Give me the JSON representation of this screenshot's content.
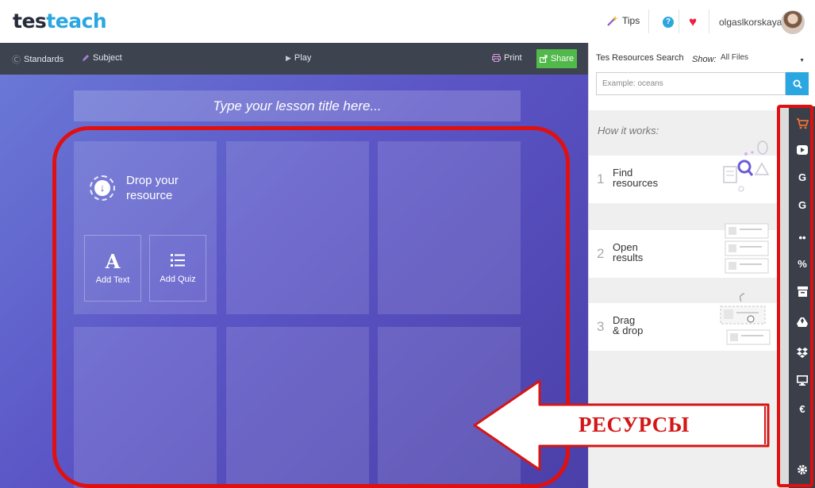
{
  "header": {
    "logo": {
      "tes": "tes",
      "teach": "teach"
    },
    "tips_label": "Tips",
    "username": "olgaslkorskaya"
  },
  "toolbar": {
    "standards_label": "Standards",
    "subject_label": "Subject",
    "play_label": "Play",
    "print_label": "Print",
    "share_label": "Share"
  },
  "lesson": {
    "title_placeholder": "Type your lesson title here...",
    "drop_text_line1": "Drop your",
    "drop_text_line2": "resource",
    "add_text_label": "Add Text",
    "add_quiz_label": "Add Quiz"
  },
  "resources_panel": {
    "title": "Tes Resources Search",
    "show_label": "Show:",
    "filter_value": "All Files",
    "search_placeholder": "Example: oceans",
    "how_it_works": "How it works:",
    "steps": [
      {
        "num": "1",
        "line1": "Find",
        "line2": "resources"
      },
      {
        "num": "2",
        "line1": "Open",
        "line2": "results"
      },
      {
        "num": "3",
        "line1": "Drag",
        "line2": "& drop"
      }
    ]
  },
  "source_strip": {
    "icons": [
      "cart-icon",
      "video-play-icon",
      "google-search-icon",
      "google-images-icon",
      "flickr-icon",
      "link-icon",
      "archive-icon",
      "google-drive-icon",
      "dropbox-icon",
      "monitor-icon",
      "tes-icon",
      "settings-icon"
    ]
  },
  "annotation": {
    "label": "РЕСУРСЫ",
    "color": "#e01010"
  },
  "colors": {
    "accent": "#2aa6e0",
    "share_green": "#50b94a",
    "toolbar": "#3e4350",
    "heart": "#e8223f"
  }
}
